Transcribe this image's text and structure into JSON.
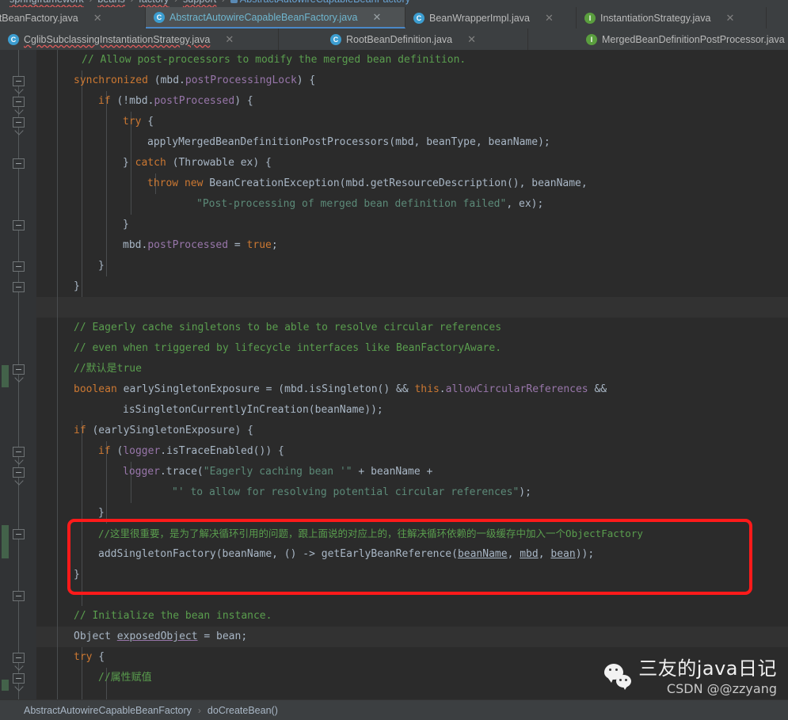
{
  "breadcrumb_top": {
    "segments": [
      "springframework",
      "beans",
      "factory",
      "support"
    ],
    "current_class": "AbstractAutowireCapableBeanFactory"
  },
  "tabs_row1": [
    {
      "label": "tractBeanFactory.java",
      "icon": "",
      "active": false,
      "error": false,
      "closable": true
    },
    {
      "label": "AbstractAutowireCapableBeanFactory.java",
      "icon": "class-icon",
      "active": true,
      "error": false,
      "closable": true
    },
    {
      "label": "BeanWrapperImpl.java",
      "icon": "class-icon",
      "active": false,
      "error": false,
      "closable": true
    },
    {
      "label": "InstantiationStrategy.java",
      "icon": "interface-icon",
      "active": false,
      "error": false,
      "closable": true
    }
  ],
  "tabs_row2": [
    {
      "label": "CglibSubclassingInstantiationStrategy.java",
      "icon": "class-icon",
      "active": false,
      "error": true,
      "closable": true
    },
    {
      "label": "RootBeanDefinition.java",
      "icon": "class-icon",
      "active": false,
      "error": false,
      "closable": true
    },
    {
      "label": "MergedBeanDefinitionPostProcessor.java",
      "icon": "interface-icon",
      "active": false,
      "error": false,
      "closable": false
    }
  ],
  "code_lines": [
    {
      "indent": 2,
      "text": "// Allow post-processors to modify the merged bean definition."
    },
    {
      "indent": 2,
      "text": "synchronized (mbd.postProcessingLock) {"
    },
    {
      "indent": 3,
      "text": "if (!mbd.postProcessed) {"
    },
    {
      "indent": 4,
      "text": "try {"
    },
    {
      "indent": 5,
      "text": "applyMergedBeanDefinitionPostProcessors(mbd, beanType, beanName);"
    },
    {
      "indent": 4,
      "text": "} catch (Throwable ex) {"
    },
    {
      "indent": 5,
      "text": "throw new BeanCreationException(mbd.getResourceDescription(), beanName,"
    },
    {
      "indent": 7,
      "text": "\"Post-processing of merged bean definition failed\", ex);"
    },
    {
      "indent": 4,
      "text": "}"
    },
    {
      "indent": 4,
      "text": "mbd.postProcessed = true;"
    },
    {
      "indent": 3,
      "text": "}"
    },
    {
      "indent": 2,
      "text": "}"
    },
    {
      "indent": 0,
      "text": ""
    },
    {
      "indent": 2,
      "text": "// Eagerly cache singletons to be able to resolve circular references"
    },
    {
      "indent": 2,
      "text": "// even when triggered by lifecycle interfaces like BeanFactoryAware."
    },
    {
      "indent": 2,
      "text": "//默认是true"
    },
    {
      "indent": 2,
      "text": "boolean earlySingletonExposure = (mbd.isSingleton() && this.allowCircularReferences &&"
    },
    {
      "indent": 4,
      "text": "isSingletonCurrentlyInCreation(beanName));"
    },
    {
      "indent": 2,
      "text": "if (earlySingletonExposure) {"
    },
    {
      "indent": 3,
      "text": "if (logger.isTraceEnabled()) {"
    },
    {
      "indent": 4,
      "text": "logger.trace(\"Eagerly caching bean '\" + beanName +"
    },
    {
      "indent": 6,
      "text": "\"' to allow for resolving potential circular references\");"
    },
    {
      "indent": 3,
      "text": "}"
    },
    {
      "indent": 3,
      "text": "//这里很重要，是为了解决循环引用的问题，跟上面说的对应上的，往解决循环依赖的一级缓存中加入一个ObjectFactory"
    },
    {
      "indent": 3,
      "text": "addSingletonFactory(beanName, () -> getEarlyBeanReference(beanName, mbd, bean));"
    },
    {
      "indent": 2,
      "text": "}"
    },
    {
      "indent": 0,
      "text": ""
    },
    {
      "indent": 2,
      "text": "// Initialize the bean instance."
    },
    {
      "indent": 2,
      "text": "Object exposedObject = bean;"
    },
    {
      "indent": 2,
      "text": "try {"
    },
    {
      "indent": 3,
      "text": "//属性赋值"
    }
  ],
  "annotation": {
    "box_color": "#ff1a1a",
    "highlighted_comment": "//这里很重要，是为了解决循环引用的问题，跟上面说的对应上的，往解决循环依赖的一级缓存中加入一个ObjectFactory",
    "highlighted_statement": "addSingletonFactory(beanName, () -> getEarlyBeanReference(beanName, mbd, bean));"
  },
  "statusbar": {
    "class_name": "AbstractAutowireCapableBeanFactory",
    "separator": "›",
    "method_name": "doCreateBean()"
  },
  "watermark": {
    "logo": "wechat-icon",
    "title": "三友的java日记",
    "subtitle": "CSDN @@zzyang"
  },
  "colors": {
    "editor_bg": "#2b2b2b",
    "gutter_bg": "#313335",
    "chrome_bg": "#3c3f41",
    "active_tab_bg": "#4e5254",
    "active_tab_text": "#6fb6cf",
    "comment_green": "#5a9e4e",
    "keyword_orange": "#cc7832",
    "field_purple": "#9876aa",
    "string_green": "#6a8759",
    "default_text": "#a9b7c6",
    "annotation_red": "#ff1a1a",
    "vcs_green": "#43624a"
  }
}
